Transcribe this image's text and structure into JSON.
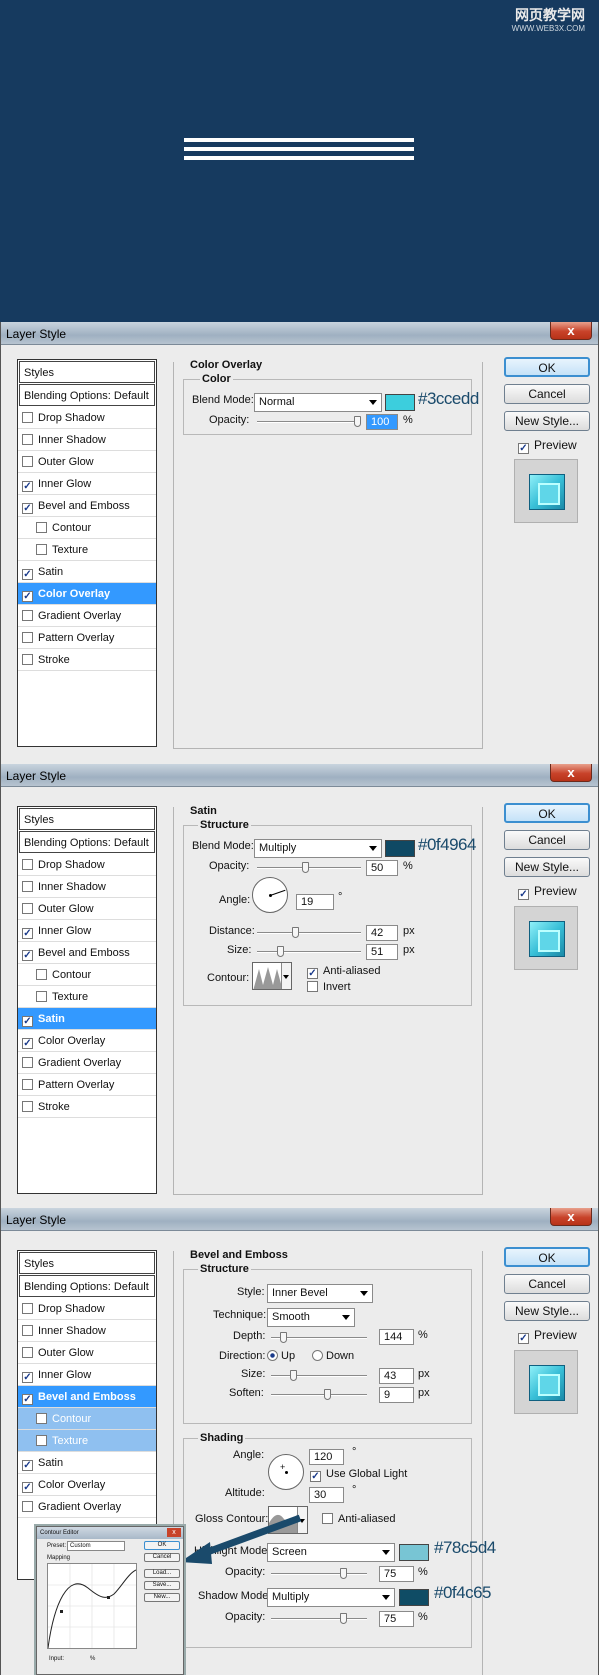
{
  "watermark": {
    "line1": "网页教学网",
    "line2": "WWW.WEB3X.COM"
  },
  "dialogs": [
    {
      "title": "Layer Style",
      "close": "x",
      "list_header": "Styles",
      "items": [
        {
          "label": "Blending Options: Default",
          "checked": null,
          "state": "header"
        },
        {
          "label": "Drop Shadow",
          "checked": false
        },
        {
          "label": "Inner Shadow",
          "checked": false
        },
        {
          "label": "Outer Glow",
          "checked": false
        },
        {
          "label": "Inner Glow",
          "checked": true
        },
        {
          "label": "Bevel and Emboss",
          "checked": true
        },
        {
          "label": "Contour",
          "checked": false,
          "state": "sub"
        },
        {
          "label": "Texture",
          "checked": false,
          "state": "sub"
        },
        {
          "label": "Satin",
          "checked": true
        },
        {
          "label": "Color Overlay",
          "checked": true,
          "state": "sel"
        },
        {
          "label": "Gradient Overlay",
          "checked": false
        },
        {
          "label": "Pattern Overlay",
          "checked": false
        },
        {
          "label": "Stroke",
          "checked": false
        }
      ],
      "section_title": "Color Overlay",
      "group_title": "Color",
      "blend_label": "Blend Mode:",
      "blend_value": "Normal",
      "swatch_color": "#3ccedd",
      "hex": "#3ccedd",
      "opacity_label": "Opacity:",
      "opacity_value": "100",
      "opacity_unit": "%",
      "opacity_level": 100
    },
    {
      "title": "Layer Style",
      "close": "x",
      "list_header": "Styles",
      "items": [
        {
          "label": "Blending Options: Default",
          "checked": null,
          "state": "header"
        },
        {
          "label": "Drop Shadow",
          "checked": false
        },
        {
          "label": "Inner Shadow",
          "checked": false
        },
        {
          "label": "Outer Glow",
          "checked": false
        },
        {
          "label": "Inner Glow",
          "checked": true
        },
        {
          "label": "Bevel and Emboss",
          "checked": true
        },
        {
          "label": "Contour",
          "checked": false,
          "state": "sub"
        },
        {
          "label": "Texture",
          "checked": false,
          "state": "sub"
        },
        {
          "label": "Satin",
          "checked": true,
          "state": "sel"
        },
        {
          "label": "Color Overlay",
          "checked": true
        },
        {
          "label": "Gradient Overlay",
          "checked": false
        },
        {
          "label": "Pattern Overlay",
          "checked": false
        },
        {
          "label": "Stroke",
          "checked": false
        }
      ],
      "section_title": "Satin",
      "group_title": "Structure",
      "blend_label": "Blend Mode:",
      "blend_value": "Multiply",
      "swatch_color": "#0f4964",
      "hex": "#0f4964",
      "opacity_label": "Opacity:",
      "opacity_value": "50",
      "opacity_unit": "%",
      "angle_label": "Angle:",
      "angle_value": "19",
      "angle_unit": "°",
      "distance_label": "Distance:",
      "distance_value": "42",
      "distance_unit": "px",
      "size_label": "Size:",
      "size_value": "51",
      "size_unit": "px",
      "contour_label": "Contour:",
      "anti_aliased_label": "Anti-aliased",
      "anti_aliased": true,
      "invert_label": "Invert",
      "invert": false
    },
    {
      "title": "Layer Style",
      "close": "x",
      "list_header": "Styles",
      "items": [
        {
          "label": "Blending Options: Default",
          "checked": null,
          "state": "header"
        },
        {
          "label": "Drop Shadow",
          "checked": false
        },
        {
          "label": "Inner Shadow",
          "checked": false
        },
        {
          "label": "Outer Glow",
          "checked": false
        },
        {
          "label": "Inner Glow",
          "checked": true
        },
        {
          "label": "Bevel and Emboss",
          "checked": true,
          "state": "sel"
        },
        {
          "label": "Contour",
          "checked": false,
          "state": "subsel"
        },
        {
          "label": "Texture",
          "checked": false,
          "state": "subsel"
        },
        {
          "label": "Satin",
          "checked": true
        },
        {
          "label": "Color Overlay",
          "checked": true
        },
        {
          "label": "Gradient Overlay",
          "checked": false
        }
      ],
      "section_title": "Bevel and Emboss",
      "structure_title": "Structure",
      "style_label": "Style:",
      "style_value": "Inner Bevel",
      "technique_label": "Technique:",
      "technique_value": "Smooth",
      "depth_label": "Depth:",
      "depth_value": "144",
      "depth_unit": "%",
      "direction_label": "Direction:",
      "dir_up": "Up",
      "dir_down": "Down",
      "size_label": "Size:",
      "size_value": "43",
      "size_unit": "px",
      "soften_label": "Soften:",
      "soften_value": "9",
      "soften_unit": "px",
      "shading_title": "Shading",
      "angle_label": "Angle:",
      "angle_value": "120",
      "angle_unit": "°",
      "global_light_label": "Use Global Light",
      "altitude_label": "Altitude:",
      "altitude_value": "30",
      "altitude_unit": "°",
      "gloss_label": "Gloss Contour:",
      "gloss_anti_label": "Anti-aliased",
      "highlight_label": "Highlight Mode:",
      "highlight_value": "Screen",
      "highlight_color": "#78c5d4",
      "highlight_hex": "#78c5d4",
      "hl_opacity_label": "Opacity:",
      "hl_opacity_value": "75",
      "hl_opacity_unit": "%",
      "shadow_label": "Shadow Mode:",
      "shadow_value": "Multiply",
      "shadow_color": "#0f4c65",
      "shadow_hex": "#0f4c65",
      "sh_opacity_label": "Opacity:",
      "sh_opacity_value": "75",
      "sh_opacity_unit": "%"
    }
  ],
  "buttons": {
    "ok": "OK",
    "cancel": "Cancel",
    "new_style": "New Style...",
    "preview": "Preview"
  },
  "contour_editor": {
    "title": "Contour Editor",
    "preset_label": "Preset:",
    "preset_value": "Custom",
    "mapping_label": "Mapping",
    "input_label": "Input:",
    "input_unit": "%",
    "ok": "OK",
    "cancel": "Cancel",
    "load": "Load...",
    "save": "Save...",
    "new": "New..."
  }
}
